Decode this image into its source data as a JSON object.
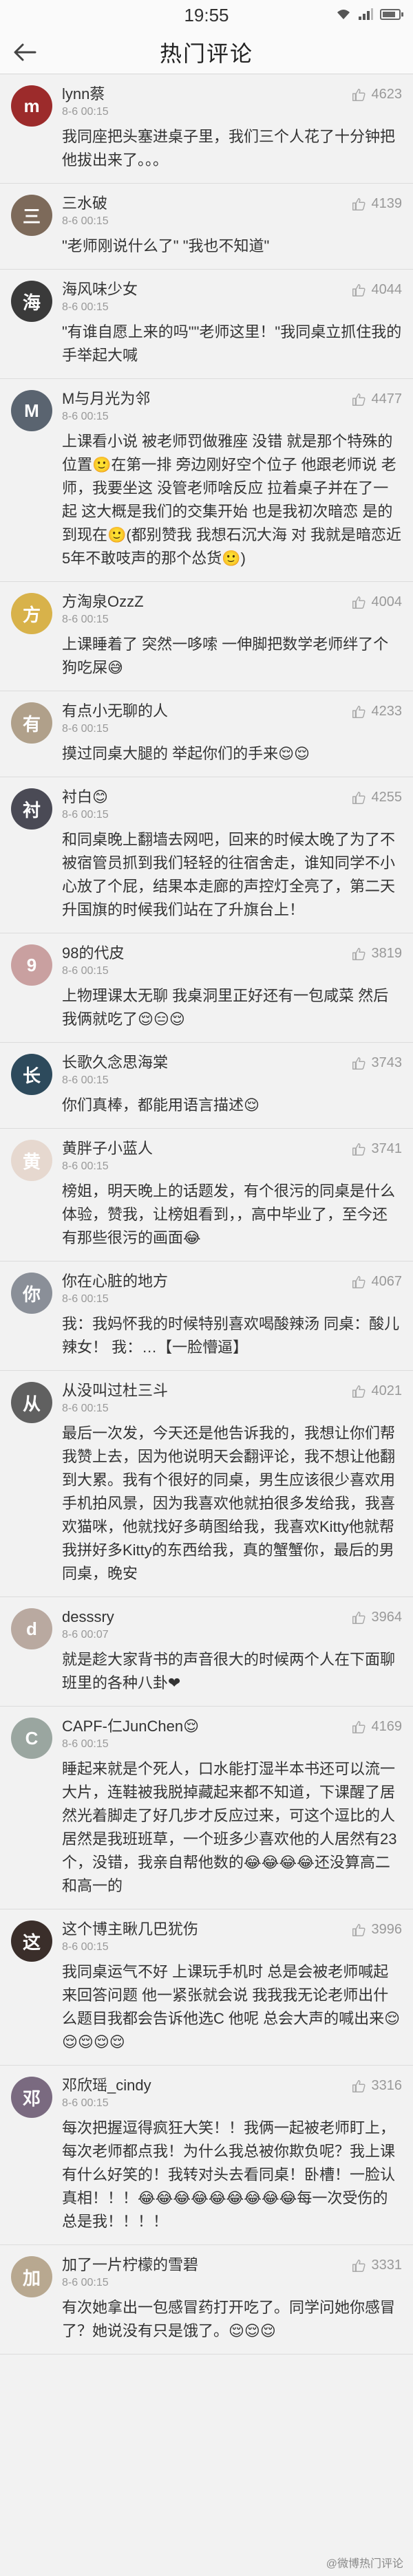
{
  "status_bar": {
    "time": "19:55"
  },
  "header": {
    "title": "热门评论"
  },
  "comments": [
    {
      "name": "lynn蔡",
      "time": "8-6 00:15",
      "likes": "4623",
      "avatar_color": "#9c2b2b",
      "avatar_char": "m",
      "text": "我同座把头塞进桌子里，我们三个人花了十分钟把他拔出来了。。。"
    },
    {
      "name": "三水破",
      "time": "8-6 00:15",
      "likes": "4139",
      "avatar_color": "#7d6a5a",
      "avatar_char": "三",
      "text": "\"老师刚说什么了\"    \"我也不知道\""
    },
    {
      "name": "海风味少女",
      "time": "8-6 00:15",
      "likes": "4044",
      "avatar_color": "#3a3a3a",
      "avatar_char": "海",
      "text": "\"有谁自愿上来的吗\"\"老师这里！\"我同桌立抓住我的手举起大喊"
    },
    {
      "name": "M与月光为邻",
      "time": "8-6 00:15",
      "likes": "4477",
      "avatar_color": "#5a6470",
      "avatar_char": "M",
      "text": "上课看小说 被老师罚做雅座 没错 就是那个特殊的位置🙂在第一排 旁边刚好空个位子 他跟老师说 老师，我要坐这 没管老师啥反应 拉着桌子并在了一起 这大概是我们的交集开始 也是我初次暗恋 是的 到现在🙂(都别赞我 我想石沉大海 对 我就是暗恋近5年不敢吱声的那个怂货🙂)"
    },
    {
      "name": "方淘泉OzzZ",
      "time": "8-6 00:15",
      "likes": "4004",
      "avatar_color": "#d8b24a",
      "avatar_char": "方",
      "text": "上课睡着了 突然一哆嗦 一伸脚把数学老师绊了个狗吃屎😅"
    },
    {
      "name": "有点小无聊的人",
      "time": "8-6 00:15",
      "likes": "4233",
      "avatar_color": "#b0a08a",
      "avatar_char": "有",
      "text": "摸过同桌大腿的 举起你们的手来😌😌"
    },
    {
      "name": "衬白😊",
      "time": "8-6 00:15",
      "likes": "4255",
      "avatar_color": "#4a4a55",
      "avatar_char": "衬",
      "text": "和同桌晚上翻墙去网吧，回来的时候太晚了为了不被宿管员抓到我们轻轻的往宿舍走，谁知同学不小心放了个屁，结果本走廊的声控灯全亮了，第二天升国旗的时候我们站在了升旗台上！"
    },
    {
      "name": "98的代皮",
      "time": "8-6 00:15",
      "likes": "3819",
      "avatar_color": "#c9a0a0",
      "avatar_char": "9",
      "text": "上物理课太无聊 我桌洞里正好还有一包咸菜 然后我俩就吃了😌😑😌"
    },
    {
      "name": "长歌久念思海棠",
      "time": "8-6 00:15",
      "likes": "3743",
      "avatar_color": "#2d4a5c",
      "avatar_char": "长",
      "text": "你们真棒，都能用语言描述😌"
    },
    {
      "name": "黄胖子小蓝人",
      "time": "8-6 00:15",
      "likes": "3741",
      "avatar_color": "#e6d8cf",
      "avatar_char": "黄",
      "text": "榜姐，明天晚上的话题发，有个很污的同桌是什么体验，赞我，让榜姐看到，，高中毕业了，至今还有那些很污的画面😂"
    },
    {
      "name": "你在心脏的地方",
      "time": "8-6 00:15",
      "likes": "4067",
      "avatar_color": "#8a8f98",
      "avatar_char": "你",
      "text": "我：我妈怀我的时候特别喜欢喝酸辣汤 同桌：酸儿辣女！ 我：…【一脸懵逼】"
    },
    {
      "name": "从没叫过杜三斗",
      "time": "8-6 00:15",
      "likes": "4021",
      "avatar_color": "#606060",
      "avatar_char": "从",
      "text": "最后一次发，今天还是他告诉我的，我想让你们帮我赞上去，因为他说明天会翻评论，我不想让他翻到大累。我有个很好的同桌，男生应该很少喜欢用手机拍风景，因为我喜欢他就拍很多发给我，我喜欢猫咪，他就找好多萌图给我，我喜欢Kitty他就帮我拼好多Kitty的东西给我，真的蟹蟹你，最后的男同桌，晚安"
    },
    {
      "name": "desssry",
      "time": "8-6 00:07",
      "likes": "3964",
      "avatar_color": "#b9a9a0",
      "avatar_char": "d",
      "text": "就是趁大家背书的声音很大的时候两个人在下面聊班里的各种八卦❤"
    },
    {
      "name": "CAPF-仁JunChen😌",
      "time": "8-6 00:15",
      "likes": "4169",
      "avatar_color": "#9aa6a0",
      "avatar_char": "C",
      "text": "睡起来就是个死人，口水能打湿半本书还可以流一大片，连鞋被我脱掉藏起来都不知道，下课醒了居然光着脚走了好几步才反应过来，可这个逗比的人居然是我班班草，一个班多少喜欢他的人居然有23个，没错，我亲自帮他数的😂😂😂😂还没算高二和高一的"
    },
    {
      "name": "这个博主瞅几巴犹伤",
      "time": "8-6 00:15",
      "likes": "3996",
      "avatar_color": "#3a2e2a",
      "avatar_char": "这",
      "text": "我同桌运气不好 上课玩手机时 总是会被老师喊起来回答问题 他一紧张就会说 我我我无论老师出什么题目我都会告诉他选C 他呢 总会大声的喊出来😌😌😌😌😌"
    },
    {
      "name": "邓欣瑶_cindy",
      "time": "8-6 00:15",
      "likes": "3316",
      "avatar_color": "#7a6a80",
      "avatar_char": "邓",
      "text": "每次把握逗得疯狂大笑！！我俩一起被老师盯上，每次老师都点我！为什么我总被你欺负呢？我上课有什么好笑的！我转对头去看同桌！卧槽！一脸认真相！！！😂😂😂😂😂😂😂😂😂每一次受伤的总是我！！！！"
    },
    {
      "name": "加了一片柠檬的雪碧",
      "time": "8-6 00:15",
      "likes": "3331",
      "avatar_color": "#b8a890",
      "avatar_char": "加",
      "text": "有次她拿出一包感冒药打开吃了。同学问她你感冒了？她说没有只是饿了。😌😌😌"
    }
  ],
  "footer": {
    "mark": "@微博热门评论"
  }
}
